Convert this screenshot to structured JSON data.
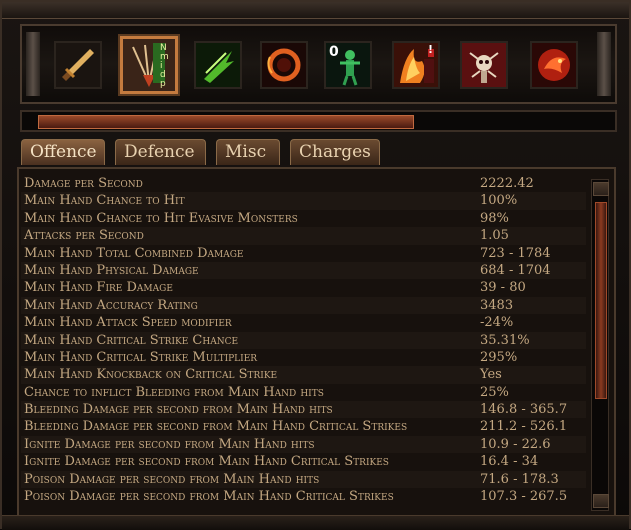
{
  "skills": [
    {
      "icon": "dagger-icon",
      "label": ""
    },
    {
      "icon": "arrow-rain-icon",
      "label": "Nmidp"
    },
    {
      "icon": "green-blade-icon",
      "label": ""
    },
    {
      "icon": "fire-ring-icon",
      "label": ""
    },
    {
      "icon": "green-figure-icon",
      "label": "0"
    },
    {
      "icon": "flame-figure-icon",
      "label": "!"
    },
    {
      "icon": "skull-totem-icon",
      "label": ""
    },
    {
      "icon": "red-dragon-icon",
      "label": ""
    }
  ],
  "progress": {
    "fraction": 0.66
  },
  "tabs": [
    "Offence",
    "Defence",
    "Misc",
    "Charges"
  ],
  "active_tab": "Offence",
  "stats": [
    {
      "label": "Damage per Second",
      "value": "2222.42"
    },
    {
      "label": "Main Hand Chance to Hit",
      "value": "100%"
    },
    {
      "label": "Main Hand Chance to Hit Evasive Monsters",
      "value": "98%"
    },
    {
      "label": "Attacks per Second",
      "value": "1.05"
    },
    {
      "label": "Main Hand Total Combined Damage",
      "value": "723 - 1784"
    },
    {
      "label": "Main Hand Physical Damage",
      "value": "684 - 1704"
    },
    {
      "label": "Main Hand Fire Damage",
      "value": "39 - 80"
    },
    {
      "label": "Main Hand Accuracy Rating",
      "value": "3483"
    },
    {
      "label": "Main Hand Attack Speed modifier",
      "value": "-24%"
    },
    {
      "label": "Main Hand Critical Strike Chance",
      "value": "35.31%"
    },
    {
      "label": "Main Hand Critical Strike Multiplier",
      "value": "295%"
    },
    {
      "label": "Main Hand Knockback on Critical Strike",
      "value": "Yes"
    },
    {
      "label": "Chance to inflict Bleeding from Main Hand hits",
      "value": "25%"
    },
    {
      "label": "Bleeding Damage per second from Main Hand hits",
      "value": "146.8 - 365.7"
    },
    {
      "label": "Bleeding Damage per second from Main Hand Critical Strikes",
      "value": "211.2 - 526.1"
    },
    {
      "label": "Ignite Damage per second from Main Hand hits",
      "value": "10.9 - 22.6"
    },
    {
      "label": "Ignite Damage per second from Main Hand Critical Strikes",
      "value": "16.4 - 34"
    },
    {
      "label": "Poison Damage per second from Main Hand hits",
      "value": "71.6 - 178.3"
    },
    {
      "label": "Poison Damage per second from Main Hand Critical Strikes",
      "value": "107.3 - 267.5"
    }
  ],
  "colors": {
    "accent": "#c47b3f",
    "text": "#c4a882"
  }
}
